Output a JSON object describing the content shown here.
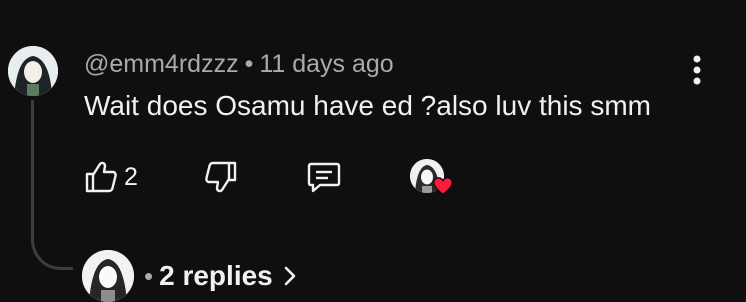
{
  "comment": {
    "author_handle": "@emm4rdzzz",
    "separator": "•",
    "timestamp": "11 days ago",
    "text": "Wait does Osamu have ed ?also luv this smm"
  },
  "actions": {
    "like_count": "2",
    "like_icon": "thumbs-up-icon",
    "dislike_icon": "thumbs-down-icon",
    "reply_icon": "reply-comment-icon",
    "creator_heart_icon": "creator-heart-icon",
    "menu_icon": "more-vertical-icon"
  },
  "replies": {
    "separator": "•",
    "label": "2 replies",
    "chevron_icon": "chevron-right-icon"
  },
  "colors": {
    "background": "#0f0f0f",
    "primary_text": "#f1f1f1",
    "secondary_text": "#aaaaaa",
    "heart_red": "#ff1a3c",
    "thread_line": "#3d3d3d"
  }
}
